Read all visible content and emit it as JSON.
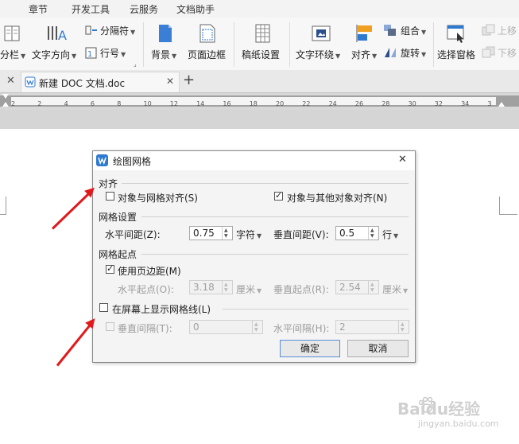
{
  "menu": {
    "items": [
      "章节",
      "开发工具",
      "云服务",
      "文档助手"
    ]
  },
  "ribbon": {
    "columns_label": "分栏",
    "text_direction_label": "文字方向",
    "separator_label": "分隔符",
    "line_number_label": "行号",
    "background_label": "背景",
    "page_border_label": "页面边框",
    "manuscript_label": "稿纸设置",
    "text_wrap_label": "文字环绕",
    "align_label": "对齐",
    "group_label": "组合",
    "rotate_label": "旋转",
    "select_pane_label": "选择窗格",
    "move_up_label": "上移",
    "move_down_label": "下移"
  },
  "tabs": {
    "document_tab_label": "新建 DOC 文档.doc",
    "new_tab_symbol": "+"
  },
  "ruler": {
    "ticks": [
      "2",
      "2",
      "4",
      "6",
      "8",
      "10",
      "12",
      "14",
      "16",
      "18",
      "20",
      "22",
      "24",
      "26",
      "28",
      "30",
      "32",
      "34",
      "3"
    ]
  },
  "dialog": {
    "title": "绘图网格",
    "align_group_label": "对齐",
    "snap_to_grid_label": "对象与网格对齐(S)",
    "snap_to_grid_checked": false,
    "snap_to_objects_label": "对象与其他对象对齐(N)",
    "snap_to_objects_checked": true,
    "grid_settings_label": "网格设置",
    "horizontal_spacing_label": "水平间距(Z):",
    "horizontal_spacing_value": "0.75",
    "horizontal_spacing_unit": "字符",
    "vertical_spacing_label": "垂直间距(V):",
    "vertical_spacing_value": "0.5",
    "vertical_spacing_unit": "行",
    "grid_origin_label": "网格起点",
    "use_margins_label": "使用页边距(M)",
    "use_margins_checked": true,
    "horizontal_origin_label": "水平起点(O):",
    "horizontal_origin_value": "3.18",
    "horizontal_origin_unit": "厘米",
    "vertical_origin_label": "垂直起点(R):",
    "vertical_origin_value": "2.54",
    "vertical_origin_unit": "厘米",
    "show_gridlines_label": "在屏幕上显示网格线(L)",
    "show_gridlines_checked": false,
    "vertical_every_label": "垂直间隔(T):",
    "vertical_every_value": "0",
    "horizontal_every_label": "水平间隔(H):",
    "horizontal_every_value": "2",
    "ok_label": "确定",
    "cancel_label": "取消"
  },
  "watermark": {
    "text": "Baidu经验",
    "url": "jingyan.baidu.com"
  },
  "colors": {
    "arrow": "#e1191d",
    "wps_blue": "#2e7ad1"
  }
}
